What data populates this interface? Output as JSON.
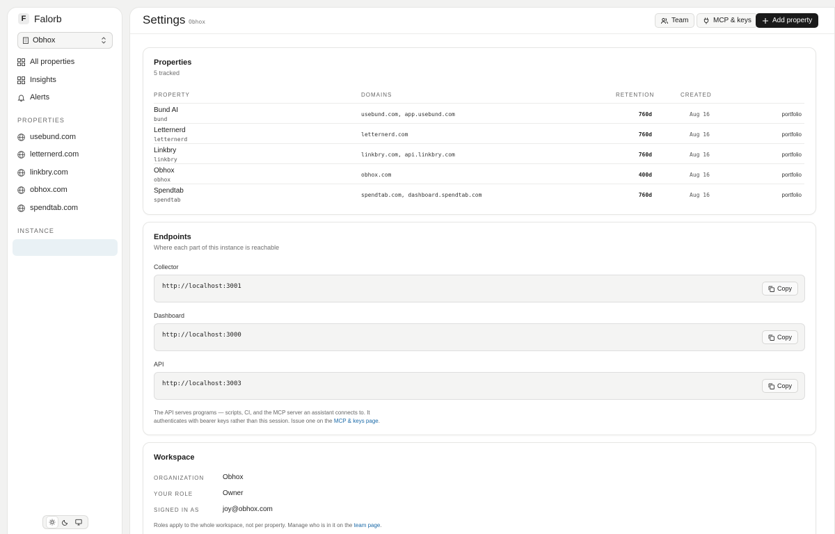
{
  "app": {
    "logo_letter": "F",
    "name": "Falorb"
  },
  "org_select": {
    "value": "Obhox"
  },
  "nav": [
    {
      "label": "All properties",
      "icon": "grid-icon"
    },
    {
      "label": "Insights",
      "icon": "grid-icon"
    },
    {
      "label": "Alerts",
      "icon": "bell-icon"
    }
  ],
  "sidebar_sections": {
    "properties": "PROPERTIES",
    "instance": "INSTANCE"
  },
  "sidebar_properties": [
    "usebund.com",
    "letternerd.com",
    "linkbry.com",
    "obhox.com",
    "spendtab.com"
  ],
  "header": {
    "title": "Settings",
    "subtitle": "Obhox",
    "team_btn": "Team",
    "mcp_btn": "MCP & keys",
    "add_btn": "Add property"
  },
  "properties_card": {
    "title": "Properties",
    "subtitle": "5 tracked",
    "columns": {
      "property": "PROPERTY",
      "domains": "DOMAINS",
      "retention": "RETENTION",
      "created": "CREATED"
    },
    "rows": [
      {
        "name": "Bund AI",
        "slug": "bund",
        "domains": "usebund.com, app.usebund.com",
        "retention": "760d",
        "created": "Aug 16",
        "tag": "portfolio"
      },
      {
        "name": "Letternerd",
        "slug": "letternerd",
        "domains": "letternerd.com",
        "retention": "760d",
        "created": "Aug 16",
        "tag": "portfolio"
      },
      {
        "name": "Linkbry",
        "slug": "linkbry",
        "domains": "linkbry.com, api.linkbry.com",
        "retention": "760d",
        "created": "Aug 16",
        "tag": "portfolio"
      },
      {
        "name": "Obhox",
        "slug": "obhox",
        "domains": "obhox.com",
        "retention": "400d",
        "created": "Aug 16",
        "tag": "portfolio"
      },
      {
        "name": "Spendtab",
        "slug": "spendtab",
        "domains": "spendtab.com, dashboard.spendtab.com",
        "retention": "760d",
        "created": "Aug 16",
        "tag": "portfolio"
      }
    ]
  },
  "endpoints_card": {
    "title": "Endpoints",
    "subtitle": "Where each part of this instance is reachable",
    "copy_label": "Copy",
    "items": [
      {
        "label": "Collector",
        "value": "http://localhost:3001"
      },
      {
        "label": "Dashboard",
        "value": "http://localhost:3000"
      },
      {
        "label": "API",
        "value": "http://localhost:3003"
      }
    ],
    "note_text": "The API serves programs — scripts, CI, and the MCP server an assistant connects to. It authenticates with bearer keys rather than this session. Issue one on the",
    "note_link": "MCP & keys page",
    "note_end": "."
  },
  "workspace_card": {
    "title": "Workspace",
    "rows": [
      {
        "key": "ORGANIZATION",
        "value": "Obhox"
      },
      {
        "key": "YOUR ROLE",
        "value": "Owner"
      },
      {
        "key": "SIGNED IN AS",
        "value": "joy@obhox.com"
      }
    ],
    "note_text": "Roles apply to the whole workspace, not per property. Manage who is in it on the",
    "note_link": "team page",
    "note_end": "."
  }
}
